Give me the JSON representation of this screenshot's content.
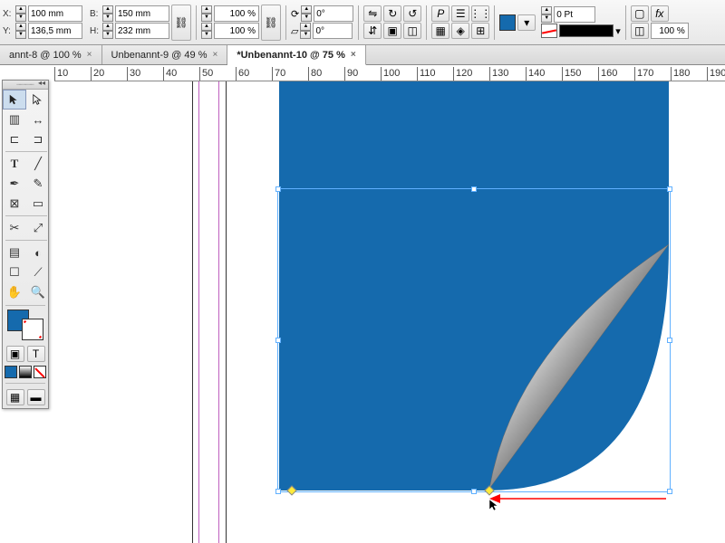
{
  "controlbar": {
    "x_label": "X:",
    "x": "100 mm",
    "y_label": "Y:",
    "y": "136,5 mm",
    "w_label": "B:",
    "w": "150 mm",
    "h_label": "H:",
    "h": "232 mm",
    "scale_x": "100 %",
    "scale_y": "100 %",
    "rot": "0°",
    "shear": "0°",
    "stroke_label": "0 Pt",
    "opacity": "100 %",
    "fill_color": "#156aad"
  },
  "tabs": [
    {
      "label": "annt-8 @ 100 %"
    },
    {
      "label": "Unbenannt-9 @ 49 %"
    },
    {
      "label": "*Unbenannt-10 @ 75 %",
      "active": true
    }
  ],
  "ruler": [
    "10",
    "20",
    "30",
    "40",
    "50",
    "60",
    "70",
    "80",
    "90",
    "100",
    "110",
    "120",
    "130",
    "140",
    "150",
    "160",
    "170",
    "180",
    "190"
  ],
  "tools": {
    "fill_color": "#156aad"
  }
}
